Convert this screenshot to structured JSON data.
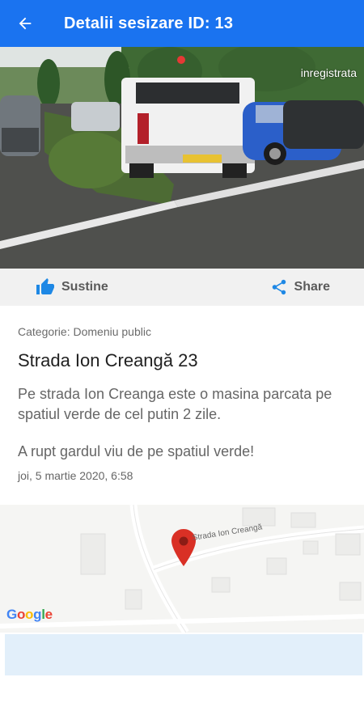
{
  "header": {
    "title": "Detalii sesizare ID: 13"
  },
  "photo": {
    "status": "inregistrata"
  },
  "actions": {
    "support_label": "Sustine",
    "share_label": "Share"
  },
  "report": {
    "category": "Categorie: Domeniu public",
    "address": "Strada Ion Creangă 23",
    "description": "Pe strada Ion Creanga este o masina parcata pe spatiul verde de cel putin 2 zile.",
    "extra": "A rupt gardul viu de pe spatiul verde!",
    "date": "joi, 5 martie 2020, 6:58"
  },
  "map": {
    "street_label": "Strada Ion Creangă",
    "provider": "Google",
    "marker_color": "#d93025"
  },
  "colors": {
    "app_bar": "#1a73f0",
    "accent": "#1e88e5"
  }
}
